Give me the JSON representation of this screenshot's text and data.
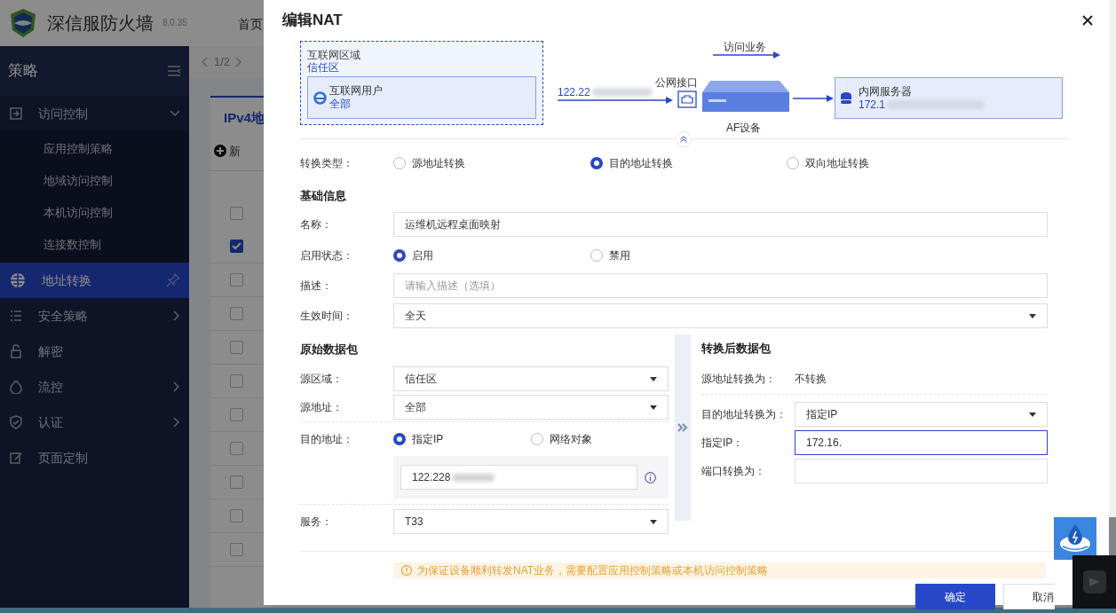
{
  "app_header": {
    "title": "深信服防火墙",
    "version": "8.0.35",
    "nav_item": "首页"
  },
  "sidebar": {
    "title": "策略",
    "items": [
      {
        "label": "访问控制",
        "selected": false,
        "expanded": true,
        "children": [
          {
            "label": "应用控制策略"
          },
          {
            "label": "地域访问控制"
          },
          {
            "label": "本机访问控制"
          },
          {
            "label": "连接数控制"
          }
        ]
      },
      {
        "label": "地址转换",
        "selected": true
      },
      {
        "label": "安全策略",
        "selected": false,
        "expanded": false
      },
      {
        "label": "解密",
        "selected": false
      },
      {
        "label": "流控",
        "selected": false,
        "expanded": false
      },
      {
        "label": "认证",
        "selected": false,
        "expanded": false
      },
      {
        "label": "页面定制",
        "selected": false
      }
    ]
  },
  "content": {
    "pager": "1/2",
    "tab": "IPv4地",
    "new_button": "新",
    "rows": [
      {
        "checked": false
      },
      {
        "checked": true
      },
      {
        "checked": false
      },
      {
        "checked": false
      },
      {
        "checked": false
      },
      {
        "checked": false
      },
      {
        "checked": false
      },
      {
        "checked": false
      },
      {
        "checked": false
      },
      {
        "checked": false
      },
      {
        "checked": false
      }
    ]
  },
  "dialog": {
    "title": "编辑NAT",
    "diagram": {
      "zone_label": "互联网区域",
      "zone": "信任区",
      "user_label": "互联网用户",
      "user_value": "全部",
      "source_ip": "122.22",
      "service_label": "访问业务",
      "interface_label": "公网接口",
      "device_label": "AF设备",
      "server_label": "内网服务器",
      "server_ip": "172.1"
    },
    "conversion_type": {
      "label": "转换类型：",
      "options": [
        {
          "label": "源地址转换",
          "selected": false
        },
        {
          "label": "目的地址转换",
          "selected": true
        },
        {
          "label": "双向地址转换",
          "selected": false
        }
      ]
    },
    "basic_info": {
      "heading": "基础信息",
      "fields": [
        {
          "kind": "text",
          "label": "名称：",
          "value": "运维机远程桌面映射"
        },
        {
          "kind": "radio",
          "label": "启用状态：",
          "options": [
            {
              "label": "启用",
              "selected": true
            },
            {
              "label": "禁用",
              "selected": false
            }
          ]
        },
        {
          "kind": "text",
          "label": "描述：",
          "placeholder": "请输入描述（选填）"
        },
        {
          "kind": "select",
          "label": "生效时间：",
          "value": "全天"
        }
      ]
    },
    "original_packet": {
      "heading": "原始数据包",
      "fields": [
        {
          "kind": "select",
          "label": "源区域：",
          "value": "信任区"
        },
        {
          "kind": "select",
          "label": "源地址：",
          "value": "全部"
        },
        {
          "kind": "radio_input",
          "label": "目的地址：",
          "options": [
            {
              "label": "指定IP",
              "selected": true
            },
            {
              "label": "网络对象",
              "selected": false
            }
          ],
          "value": "122.228"
        },
        {
          "kind": "select",
          "label": "服务：",
          "value": "T33"
        }
      ]
    },
    "translated_packet": {
      "heading": "转换后数据包",
      "fields": [
        {
          "kind": "static",
          "label": "源地址转换为：",
          "value": "不转换"
        },
        {
          "kind": "select",
          "label": "目的地址转换为：",
          "value": "指定IP"
        },
        {
          "kind": "text",
          "label": "指定IP：",
          "value": "172.16.",
          "focused": true
        },
        {
          "kind": "text",
          "label": "端口转换为：",
          "focused": false
        }
      ]
    },
    "notice": "为保证设备顺利转发NAT业务，需要配置应用控制策略或本机访问控制策略",
    "buttons": [
      {
        "label": "确定",
        "kind": "primary"
      },
      {
        "label": "取消",
        "kind": "secondary"
      }
    ]
  }
}
